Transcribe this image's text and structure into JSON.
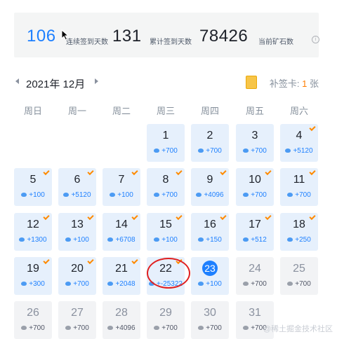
{
  "stats": {
    "streak_value": "106",
    "streak_label": "连续签到天数",
    "total_value": "131",
    "total_label": "累计签到天数",
    "ore_value": "78426",
    "ore_label": "当前矿石数",
    "info_icon": "i"
  },
  "calendar": {
    "month_label": "2021年 12月",
    "makeup_label": "补签卡:",
    "makeup_count": "1",
    "makeup_unit": "张",
    "weekdays": [
      "周日",
      "周一",
      "周二",
      "周三",
      "周四",
      "周五",
      "周六"
    ],
    "days": [
      {
        "day": "1",
        "gain": "+700",
        "status": "signed"
      },
      {
        "day": "2",
        "gain": "+700",
        "status": "signed"
      },
      {
        "day": "3",
        "gain": "+700",
        "status": "signed"
      },
      {
        "day": "4",
        "gain": "+5120",
        "status": "signed"
      },
      {
        "day": "5",
        "gain": "+100",
        "status": "signed"
      },
      {
        "day": "6",
        "gain": "+5120",
        "status": "signed"
      },
      {
        "day": "7",
        "gain": "+100",
        "status": "signed"
      },
      {
        "day": "8",
        "gain": "+700",
        "status": "signed"
      },
      {
        "day": "9",
        "gain": "+4096",
        "status": "signed"
      },
      {
        "day": "10",
        "gain": "+700",
        "status": "signed"
      },
      {
        "day": "11",
        "gain": "+700",
        "status": "signed"
      },
      {
        "day": "12",
        "gain": "+1300",
        "status": "signed"
      },
      {
        "day": "13",
        "gain": "+100",
        "status": "signed"
      },
      {
        "day": "14",
        "gain": "+6708",
        "status": "signed"
      },
      {
        "day": "15",
        "gain": "+100",
        "status": "signed"
      },
      {
        "day": "16",
        "gain": "+150",
        "status": "signed"
      },
      {
        "day": "17",
        "gain": "+512",
        "status": "signed"
      },
      {
        "day": "18",
        "gain": "+250",
        "status": "signed"
      },
      {
        "day": "19",
        "gain": "+300",
        "status": "signed"
      },
      {
        "day": "20",
        "gain": "+700",
        "status": "signed"
      },
      {
        "day": "21",
        "gain": "+2048",
        "status": "signed"
      },
      {
        "day": "22",
        "gain": "+-25322",
        "status": "signed"
      },
      {
        "day": "23",
        "gain": "+100",
        "status": "today"
      },
      {
        "day": "24",
        "gain": "+700",
        "status": "future"
      },
      {
        "day": "25",
        "gain": "+700",
        "status": "future"
      },
      {
        "day": "26",
        "gain": "+700",
        "status": "future"
      },
      {
        "day": "27",
        "gain": "+700",
        "status": "future"
      },
      {
        "day": "28",
        "gain": "+4096",
        "status": "future"
      },
      {
        "day": "29",
        "gain": "+700",
        "status": "future"
      },
      {
        "day": "30",
        "gain": "+700",
        "status": "future"
      },
      {
        "day": "31",
        "gain": "+700",
        "status": "future"
      }
    ],
    "checked_days": [
      "4",
      "5",
      "6",
      "7",
      "8",
      "9",
      "10",
      "11",
      "12",
      "13",
      "14",
      "15",
      "16",
      "17",
      "18",
      "19",
      "20",
      "21",
      "22"
    ]
  },
  "watermark": "@稀土掘金技术社区",
  "colors": {
    "accent": "#1e80ff",
    "check": "#ff8a00",
    "highlight_circle": "#e02020"
  }
}
